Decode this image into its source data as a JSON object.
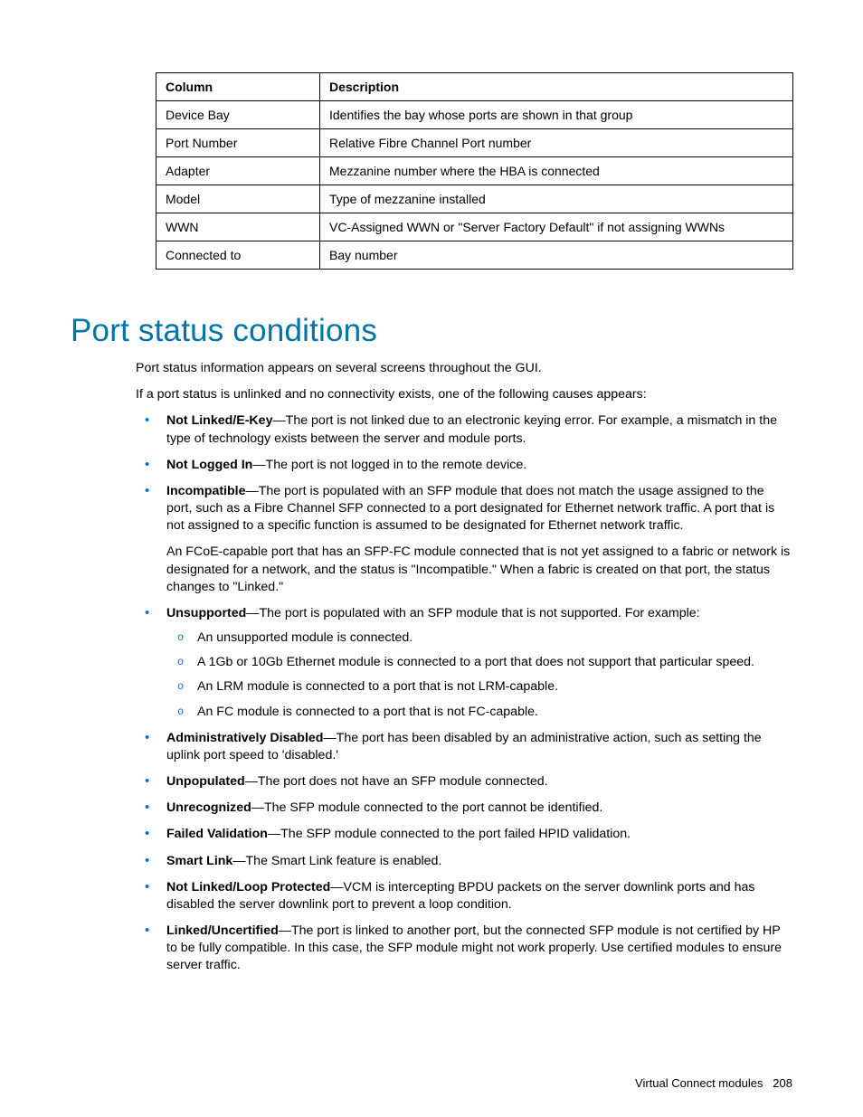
{
  "table": {
    "headers": [
      "Column",
      "Description"
    ],
    "rows": [
      {
        "c1": "Device Bay",
        "c2": "Identifies the bay whose ports are shown in that group"
      },
      {
        "c1": "Port Number",
        "c2": "Relative Fibre Channel Port number"
      },
      {
        "c1": "Adapter",
        "c2": "Mezzanine number where the HBA is connected"
      },
      {
        "c1": "Model",
        "c2": "Type of mezzanine installed"
      },
      {
        "c1": "WWN",
        "c2": "VC-Assigned WWN or \"Server Factory Default\" if not assigning WWNs"
      },
      {
        "c1": "Connected to",
        "c2": "Bay number"
      }
    ]
  },
  "heading": "Port status conditions",
  "intro1": "Port status information appears on several screens throughout the GUI.",
  "intro2": "If a port status is unlinked and no connectivity exists, one of the following causes appears:",
  "items": {
    "notLinked": {
      "term": "Not Linked/E-Key",
      "text": "—The port is not linked due to an electronic keying error. For example, a mismatch in the type of technology exists between the server and module ports."
    },
    "notLoggedIn": {
      "term": "Not Logged In",
      "text": "—The port is not logged in to the remote device."
    },
    "incompatible": {
      "term": "Incompatible",
      "text": "—The port is populated with an SFP module that does not match the usage assigned to the port, such as a Fibre Channel SFP connected to a port designated for Ethernet network traffic. A port that is not assigned to a specific function is assumed to be designated for Ethernet network traffic.",
      "extra": "An FCoE-capable port that has an SFP-FC module connected that is not yet assigned to a fabric or network is designated for a network, and the status is \"Incompatible.\" When a fabric is created on that port, the status changes to \"Linked.\""
    },
    "unsupported": {
      "term": "Unsupported",
      "text": "—The port is populated with an SFP module that is not supported. For example:",
      "sub": [
        "An unsupported module is connected.",
        "A 1Gb or 10Gb Ethernet module is connected to a port that does not support that particular speed.",
        "An LRM module is connected to a port that is not LRM-capable.",
        "An FC module is connected to a port that is not FC-capable."
      ]
    },
    "adminDisabled": {
      "term": "Administratively Disabled",
      "text": "—The port has been disabled by an administrative action, such as setting the uplink port speed to 'disabled.'"
    },
    "unpopulated": {
      "term": "Unpopulated",
      "text": "—The port does not have an SFP module connected."
    },
    "unrecognized": {
      "term": "Unrecognized",
      "text": "—The SFP module connected to the port cannot be identified."
    },
    "failedValidation": {
      "term": "Failed Validation",
      "text": "—The SFP module connected to the port failed HPID validation."
    },
    "smartLink": {
      "term": "Smart Link",
      "text": "—The Smart Link feature is enabled."
    },
    "loopProtected": {
      "term": "Not Linked/Loop Protected",
      "text": "—VCM is intercepting BPDU packets on the server downlink ports and has disabled the server downlink port to prevent a loop condition."
    },
    "linkedUncert": {
      "term": "Linked/Uncertified",
      "text": "—The port is linked to another port, but the connected SFP module is not certified by HP to be fully compatible. In this case, the SFP module might not work properly. Use certified modules to ensure server traffic."
    }
  },
  "footer": {
    "section": "Virtual Connect modules",
    "page": "208"
  }
}
